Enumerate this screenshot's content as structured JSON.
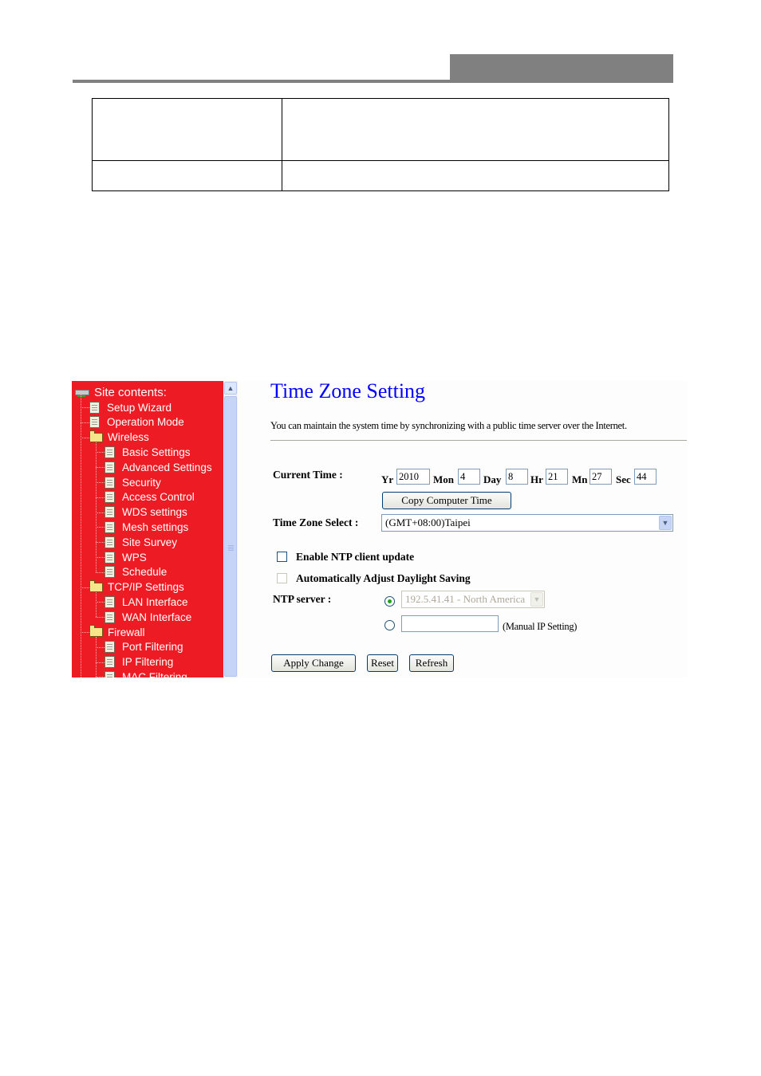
{
  "page_header": {
    "table": {
      "rows": [
        {
          "col1": "",
          "col2": ""
        },
        {
          "col1": "",
          "col2": ""
        }
      ]
    }
  },
  "sidebar": {
    "root_label": "Site contents:",
    "items": [
      {
        "label": "Setup Wizard",
        "type": "page",
        "level": 1
      },
      {
        "label": "Operation Mode",
        "type": "page",
        "level": 1
      },
      {
        "label": "Wireless",
        "type": "folder",
        "level": 1
      },
      {
        "label": "Basic Settings",
        "type": "page",
        "level": 2
      },
      {
        "label": "Advanced Settings",
        "type": "page",
        "level": 2
      },
      {
        "label": "Security",
        "type": "page",
        "level": 2
      },
      {
        "label": "Access Control",
        "type": "page",
        "level": 2
      },
      {
        "label": "WDS settings",
        "type": "page",
        "level": 2
      },
      {
        "label": "Mesh settings",
        "type": "page",
        "level": 2
      },
      {
        "label": "Site Survey",
        "type": "page",
        "level": 2
      },
      {
        "label": "WPS",
        "type": "page",
        "level": 2
      },
      {
        "label": "Schedule",
        "type": "page",
        "level": 2
      },
      {
        "label": "TCP/IP Settings",
        "type": "folder",
        "level": 1
      },
      {
        "label": "LAN Interface",
        "type": "page",
        "level": 2
      },
      {
        "label": "WAN Interface",
        "type": "page",
        "level": 2
      },
      {
        "label": "Firewall",
        "type": "folder",
        "level": 1
      },
      {
        "label": "Port Filtering",
        "type": "page",
        "level": 2
      },
      {
        "label": "IP Filtering",
        "type": "page",
        "level": 2
      },
      {
        "label": "MAC Filtering",
        "type": "page",
        "level": 2
      }
    ],
    "colors": {
      "background": "#ed1c24",
      "text": "#ffffff"
    }
  },
  "main": {
    "title": "Time Zone Setting",
    "description": "You can maintain the system time by synchronizing with a public time server over the Internet.",
    "current_time": {
      "label": "Current Time :",
      "yr_label": "Yr",
      "yr": "2010",
      "mon_label": "Mon",
      "mon": "4",
      "day_label": "Day",
      "day": "8",
      "hr_label": "Hr",
      "hr": "21",
      "mn_label": "Mn",
      "mn": "27",
      "sec_label": "Sec",
      "sec": "44"
    },
    "copy_button": "Copy Computer Time",
    "time_zone": {
      "label": "Time Zone Select :",
      "selected": "(GMT+08:00)Taipei"
    },
    "enable_ntp": {
      "label": "Enable NTP client update",
      "checked": false
    },
    "daylight": {
      "label": "Automatically Adjust Daylight Saving",
      "checked": false,
      "disabled": true
    },
    "ntp_server": {
      "label": "NTP server :",
      "preset_selected": "192.5.41.41 - North America",
      "manual_value": "",
      "manual_note": "(Manual IP Setting)"
    },
    "buttons": {
      "apply": "Apply Change",
      "reset": "Reset",
      "refresh": "Refresh"
    },
    "colors": {
      "title": "#0000ff"
    }
  }
}
